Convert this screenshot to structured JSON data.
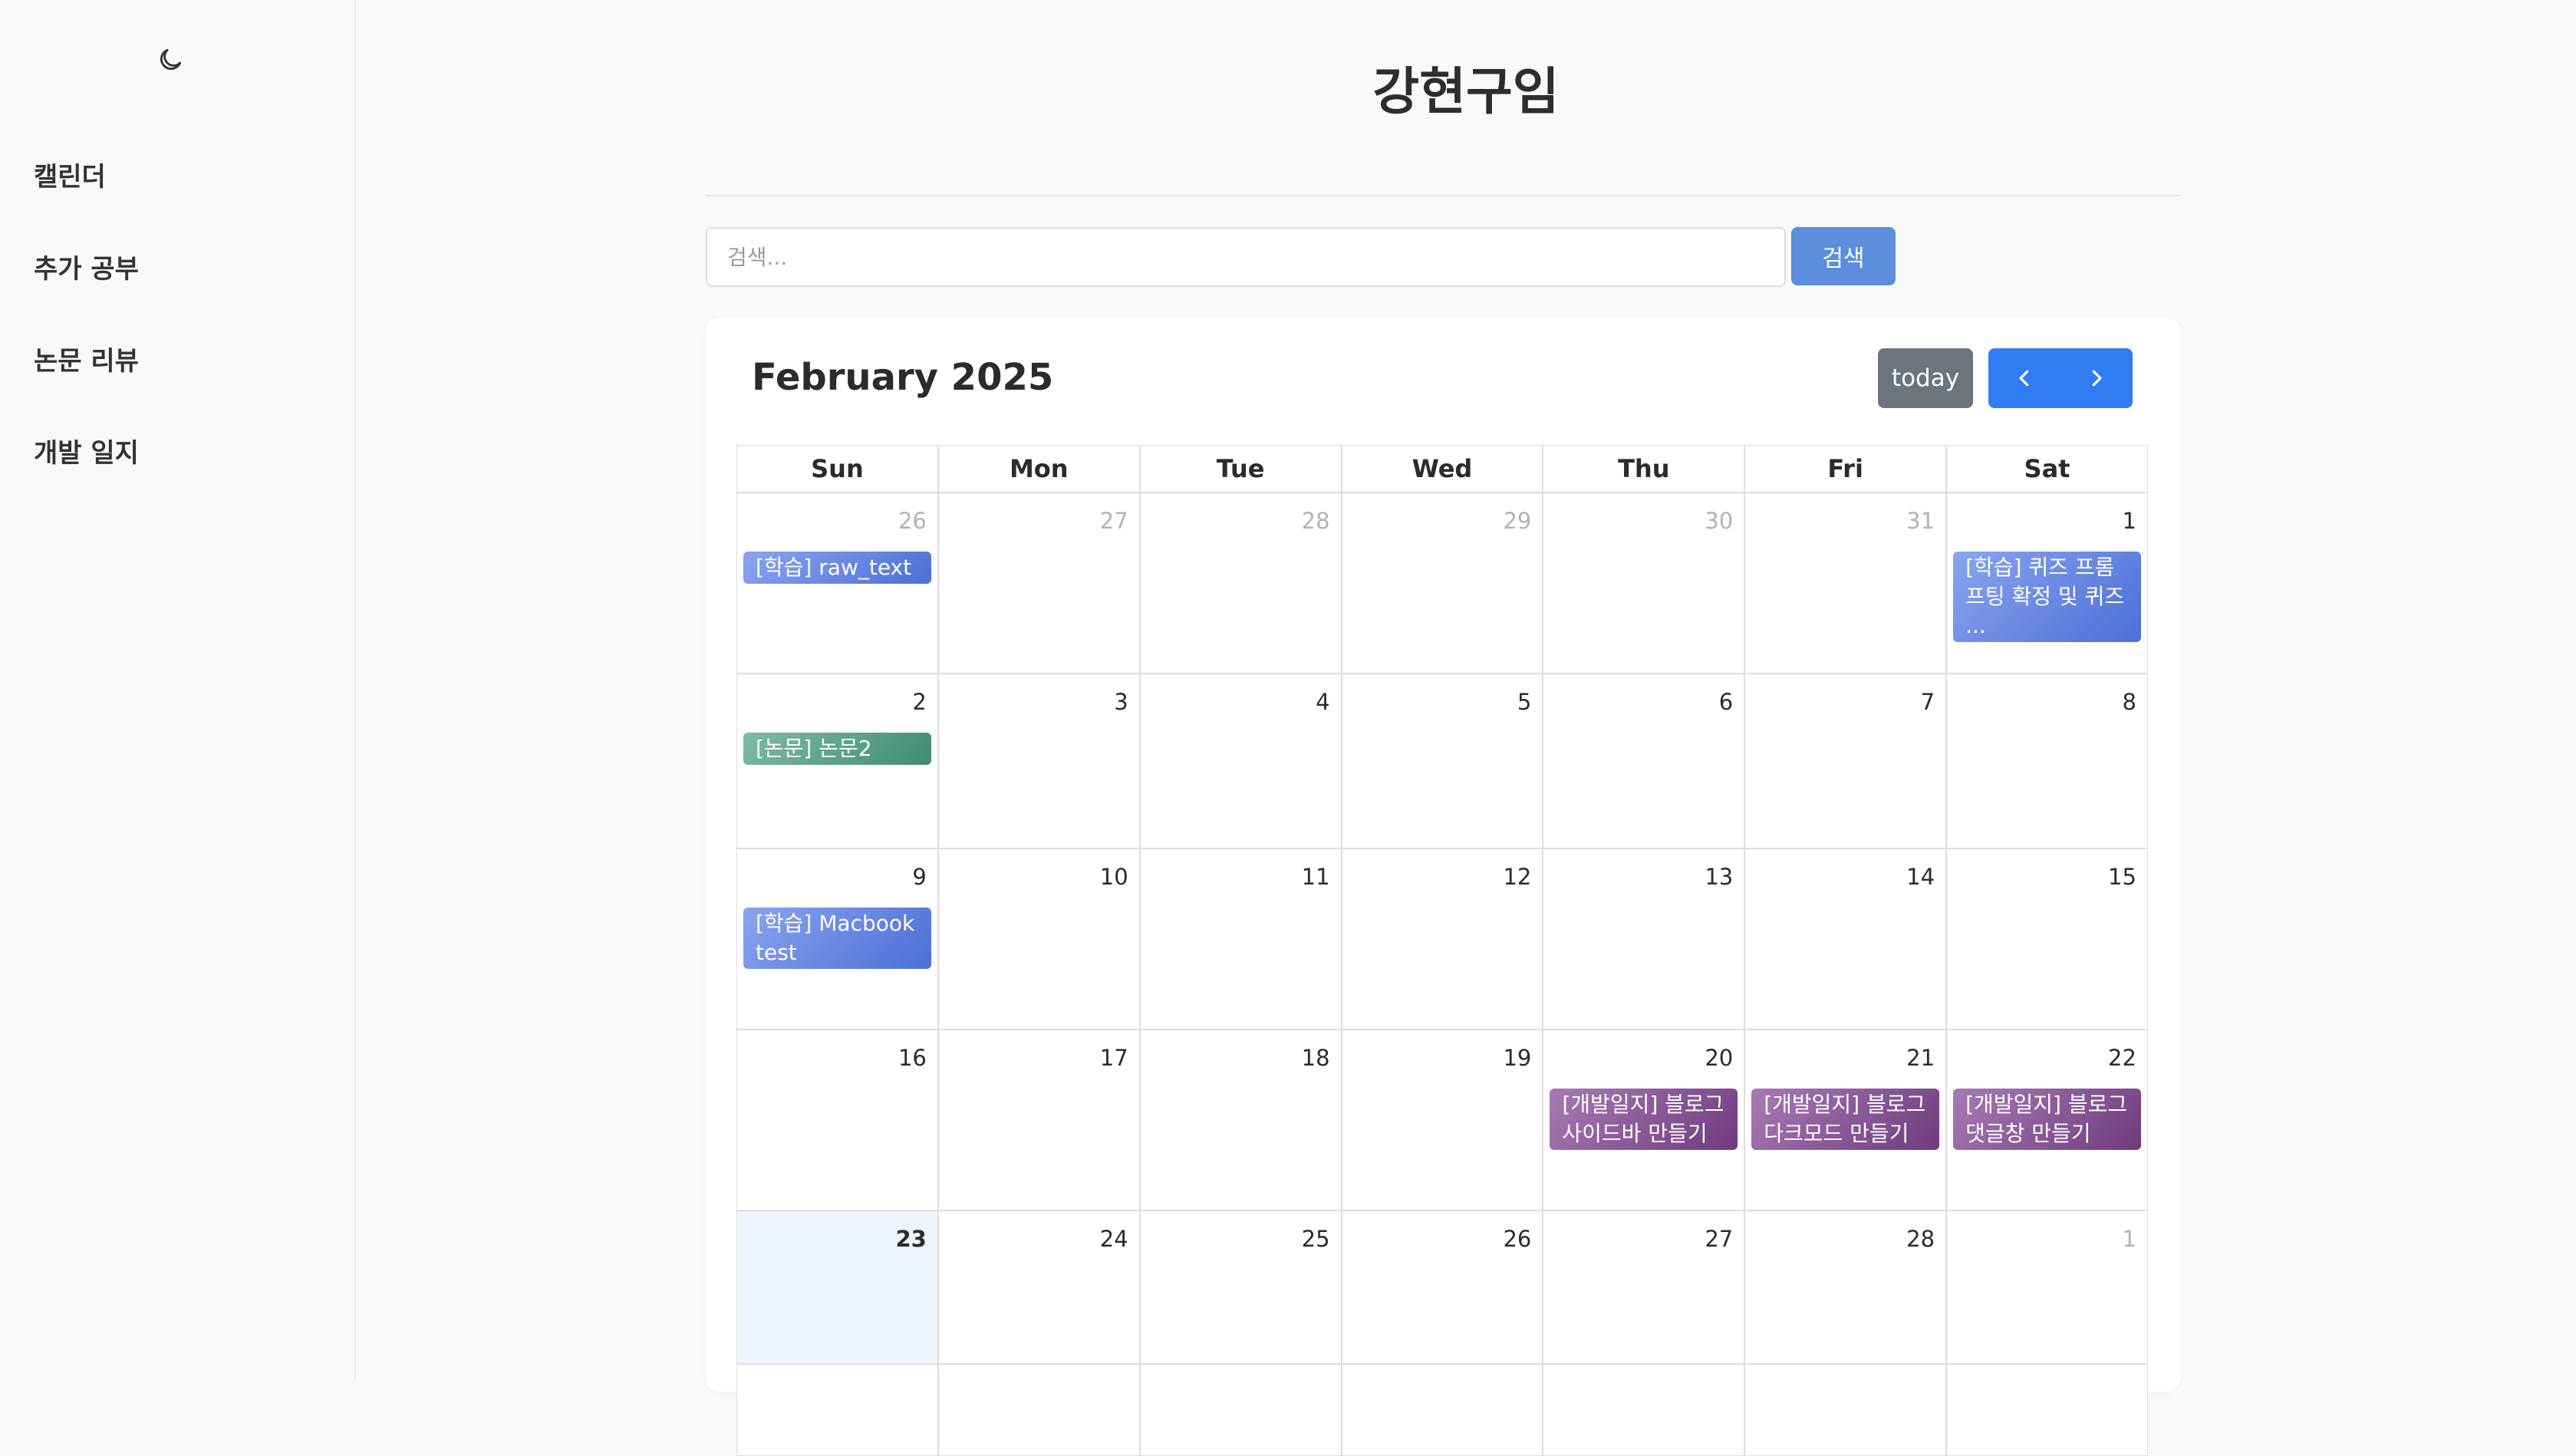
{
  "sidebar": {
    "theme_toggle_icon": "moon-icon",
    "items": [
      {
        "label": "캘린더"
      },
      {
        "label": "추가 공부"
      },
      {
        "label": "논문 리뷰"
      },
      {
        "label": "개발 일지"
      }
    ]
  },
  "header": {
    "title": "강현구임"
  },
  "search": {
    "placeholder": "검색...",
    "value": "",
    "button_label": "검색"
  },
  "calendar": {
    "title": "February 2025",
    "today_label": "today",
    "prev_icon": "chevron-left-icon",
    "next_icon": "chevron-right-icon",
    "accent_color": "#2f7cf3",
    "weekdays": [
      "Sun",
      "Mon",
      "Tue",
      "Wed",
      "Thu",
      "Fri",
      "Sat"
    ],
    "weeks": [
      {
        "days": [
          {
            "num": "26",
            "other": true,
            "event": {
              "title": "[학습] raw_text",
              "kind": "study"
            }
          },
          {
            "num": "27",
            "other": true
          },
          {
            "num": "28",
            "other": true
          },
          {
            "num": "29",
            "other": true
          },
          {
            "num": "30",
            "other": true
          },
          {
            "num": "31",
            "other": true
          },
          {
            "num": "1",
            "event": {
              "title": "[학습] 퀴즈 프롬프팅 확정 및 퀴즈 ...",
              "kind": "study"
            }
          }
        ]
      },
      {
        "days": [
          {
            "num": "2",
            "event": {
              "title": "[논문] 논문2",
              "kind": "paper"
            }
          },
          {
            "num": "3"
          },
          {
            "num": "4"
          },
          {
            "num": "5"
          },
          {
            "num": "6"
          },
          {
            "num": "7"
          },
          {
            "num": "8"
          }
        ]
      },
      {
        "days": [
          {
            "num": "9",
            "event": {
              "title": "[학습] Macbook test",
              "kind": "study"
            }
          },
          {
            "num": "10"
          },
          {
            "num": "11"
          },
          {
            "num": "12"
          },
          {
            "num": "13"
          },
          {
            "num": "14"
          },
          {
            "num": "15"
          }
        ]
      },
      {
        "days": [
          {
            "num": "16"
          },
          {
            "num": "17"
          },
          {
            "num": "18"
          },
          {
            "num": "19"
          },
          {
            "num": "20",
            "event": {
              "title": "[개발일지] 블로그 사이드바 만들기",
              "kind": "dev"
            }
          },
          {
            "num": "21",
            "event": {
              "title": "[개발일지] 블로그 다크모드 만들기",
              "kind": "dev"
            }
          },
          {
            "num": "22",
            "event": {
              "title": "[개발일지] 블로그 댓글창 만들기",
              "kind": "dev"
            }
          }
        ]
      },
      {
        "days": [
          {
            "num": "23",
            "today": true
          },
          {
            "num": "24"
          },
          {
            "num": "25"
          },
          {
            "num": "26"
          },
          {
            "num": "27"
          },
          {
            "num": "28"
          },
          {
            "num": "1",
            "other": true
          }
        ]
      },
      {
        "days": [
          {
            "num": "",
            "other": true
          },
          {
            "num": "",
            "other": true
          },
          {
            "num": "",
            "other": true
          },
          {
            "num": "",
            "other": true
          },
          {
            "num": "",
            "other": true
          },
          {
            "num": "",
            "other": true
          },
          {
            "num": "",
            "other": true
          }
        ]
      }
    ]
  }
}
